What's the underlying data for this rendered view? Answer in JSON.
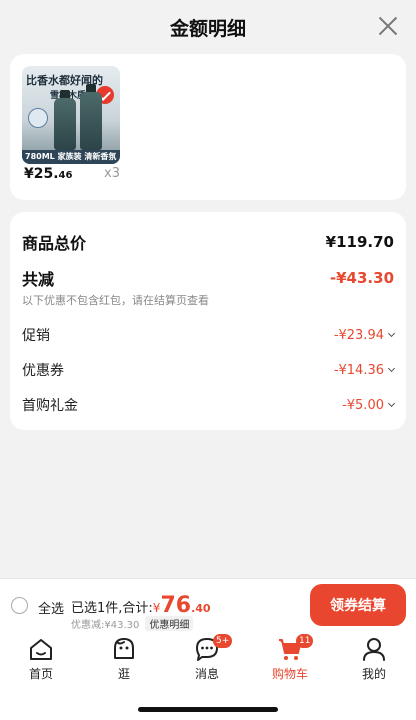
{
  "header": {
    "title": "金额明细"
  },
  "product": {
    "image_text_1": "比香水都好闻的",
    "image_text_2": "雪松木质香",
    "image_bottom_text": "780ML 家族装 清新香氛",
    "price_main": "¥25.",
    "price_decimal": "46",
    "quantity": "x3"
  },
  "details": {
    "subtotal_label": "商品总价",
    "subtotal_value": "¥119.70",
    "discount_label": "共减",
    "discount_value": "-¥43.30",
    "note": "以下优惠不包含红包，请在结算页查看",
    "items": [
      {
        "label": "促销",
        "value": "-¥23.94"
      },
      {
        "label": "优惠券",
        "value": "-¥14.36"
      },
      {
        "label": "首购礼金",
        "value": "-¥5.00"
      }
    ]
  },
  "bottom_bar": {
    "select_all": "全选",
    "selected_summary": "已选1件,合计:",
    "total_currency": "¥",
    "total_int": "76",
    "total_dec": ".40",
    "discount_text": "优惠减:¥43.30",
    "detail_link": "优惠明细",
    "checkout": "领券结算"
  },
  "tabbar": {
    "tabs": [
      {
        "label": "首页",
        "icon": "home-icon"
      },
      {
        "label": "逛",
        "icon": "explore-icon"
      },
      {
        "label": "消息",
        "icon": "message-icon",
        "badge": "5+"
      },
      {
        "label": "购物车",
        "icon": "cart-icon",
        "badge": "11",
        "active": true
      },
      {
        "label": "我的",
        "icon": "profile-icon"
      }
    ]
  },
  "colors": {
    "accent": "#e8482f",
    "background": "#f2f2f2"
  }
}
